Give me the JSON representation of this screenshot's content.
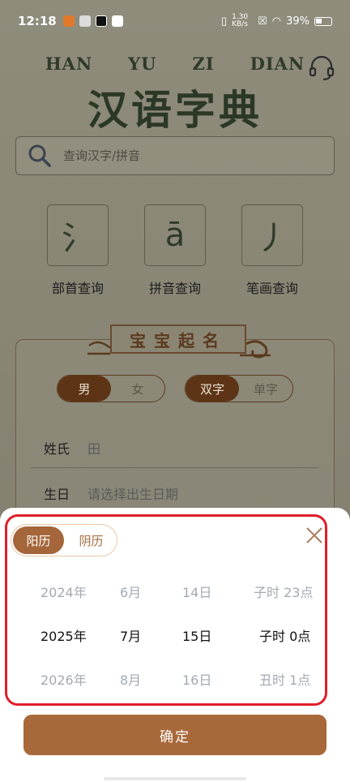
{
  "statusbar": {
    "time": "12:18",
    "net_speed": "1.30 KB/s",
    "battery": "39%"
  },
  "header": {
    "pinyin": [
      "HAN",
      "YU",
      "ZI",
      "DIAN"
    ],
    "title": "汉语字典"
  },
  "search": {
    "placeholder": "查询汉字/拼音"
  },
  "tools": [
    {
      "glyph": "氵",
      "label": "部首查询"
    },
    {
      "glyph": "ā",
      "label": "拼音查询"
    },
    {
      "glyph": "丿",
      "label": "笔画查询"
    }
  ],
  "naming": {
    "banner": "宝宝起名",
    "gender": {
      "options": [
        "男",
        "女"
      ],
      "selected": "男"
    },
    "chars": {
      "options": [
        "双字",
        "单字"
      ],
      "selected": "双字"
    },
    "surname_label": "姓氏",
    "surname_value": "田",
    "birthday_label": "生日",
    "birthday_placeholder": "请选择出生日期"
  },
  "picker": {
    "calendar_options": [
      "阳历",
      "阴历"
    ],
    "calendar_selected": "阳历",
    "years": [
      "2024年",
      "2025年",
      "2026年"
    ],
    "months": [
      "6月",
      "7月",
      "8月"
    ],
    "days": [
      "14日",
      "15日",
      "16日"
    ],
    "hours": [
      "子时 23点",
      "子时 0点",
      "丑时 1点"
    ],
    "confirm_label": "确定"
  },
  "colors": {
    "accent": "#a8693a",
    "highlight_border": "#e01e2a"
  }
}
